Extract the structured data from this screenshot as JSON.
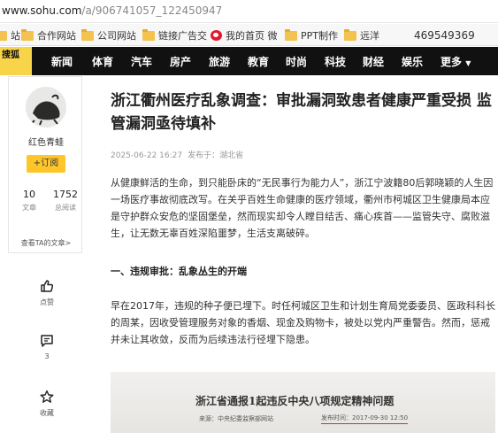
{
  "browser": {
    "url_host": "www.sohu.com",
    "url_path": "/a/906741057_122450947"
  },
  "bookmarks": {
    "items": [
      {
        "label": "合作网站",
        "icon": "folder-icon"
      },
      {
        "label": "公司网站",
        "icon": "folder-icon"
      },
      {
        "label": "链接广告交",
        "icon": "folder-icon"
      },
      {
        "label": "我的首页 微",
        "icon": "weibo-icon"
      },
      {
        "label": "PPT制作",
        "icon": "folder-icon"
      },
      {
        "label": "远洋",
        "icon": "folder-icon"
      }
    ],
    "number": "469549369"
  },
  "nav": {
    "logo": "搜狐",
    "items": [
      "新闻",
      "体育",
      "汽车",
      "房产",
      "旅游",
      "教育",
      "时尚",
      "科技",
      "财经",
      "娱乐",
      "更多"
    ]
  },
  "author": {
    "name": "红色青蛙",
    "follow_label": "+订阅",
    "articles_count": "10",
    "articles_label": "文章",
    "views_count": "1752",
    "views_label": "总阅读",
    "link_label": "查看TA的文章>"
  },
  "actions": {
    "like_label": "点赞",
    "comment_count": "3",
    "collect_label": "收藏"
  },
  "article": {
    "title": "浙江衢州医疗乱象调查：审批漏洞致患者健康严重受损 监管漏洞亟待填补",
    "date": "2025-06-22 16:27",
    "source": "发布于：湖北省",
    "para1": "从健康鲜活的生命，到只能卧床的“无民事行为能力人”，浙江宁波籍80后郭晓颖的人生因一场医疗事故彻底改写。在关乎百姓生命健康的医疗领域，衢州市柯城区卫生健康局本应是守护群众安危的坚固堡垒，然而现实却令人瞠目结舌、痛心疾首——监管失守、腐败滋生，让无数无辜百姓深陷噩梦，生活支离破碎。",
    "section1": "一、违规审批：乱象丛生的开端",
    "para2": "早在2017年，违规的种子便已埋下。时任柯城区卫生和计划生育局党委委员、医政科科长的周某，因收受管理服务对象的香烟、现金及购物卡，被处以党内严重警告。然而，惩戒并未让其收敛，反而为后续违法行径埋下隐患。",
    "image_title": "浙江省通报1起违反中央八项规定精神问题",
    "image_source": "来源：中央纪委监察部网站",
    "image_date": "发布时间：2017-09-30 12:50"
  }
}
